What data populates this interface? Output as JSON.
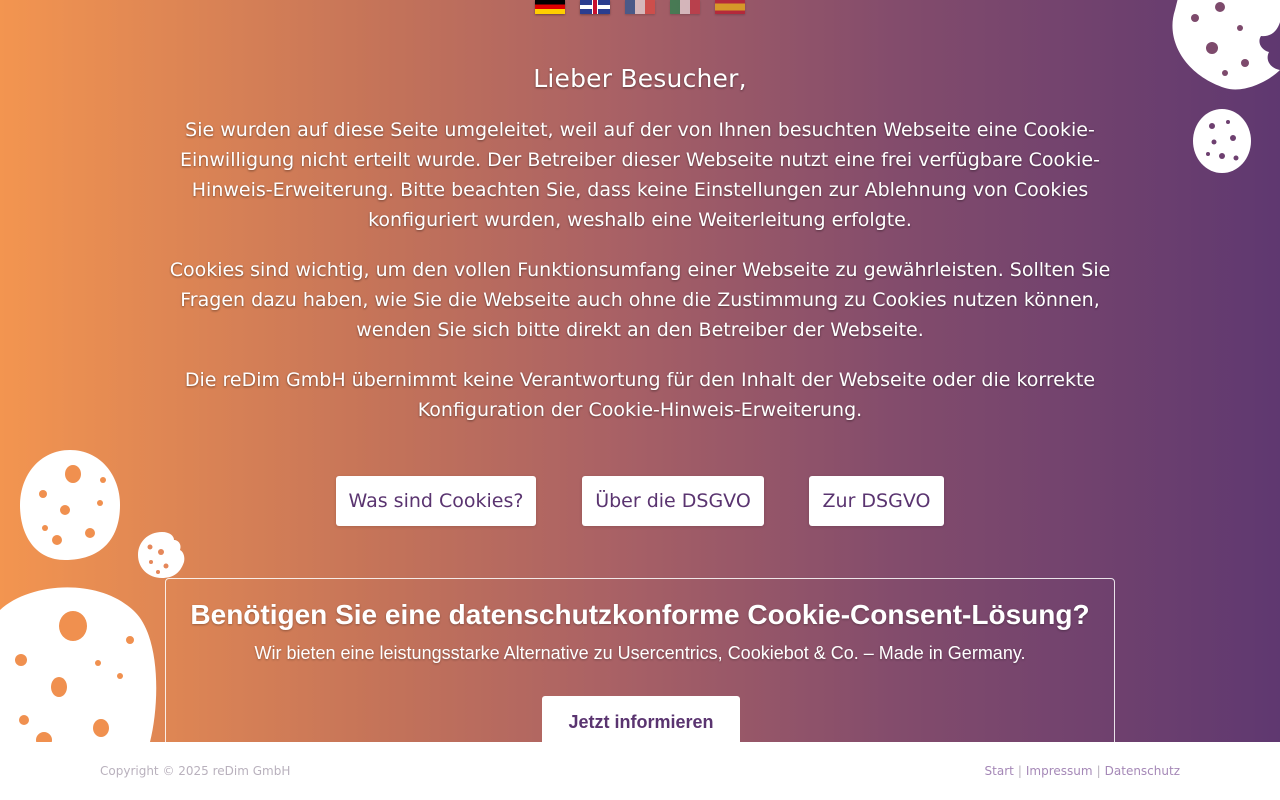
{
  "languages": [
    {
      "code": "de",
      "icon": "flag-germany-icon"
    },
    {
      "code": "en",
      "icon": "flag-uk-icon"
    },
    {
      "code": "fr",
      "icon": "flag-france-icon"
    },
    {
      "code": "it",
      "icon": "flag-italy-icon"
    },
    {
      "code": "es",
      "icon": "flag-spain-icon"
    }
  ],
  "main": {
    "greeting": "Lieber Besucher,",
    "paragraphs": [
      "Sie wurden auf diese Seite umgeleitet, weil auf der von Ihnen besuchten Webseite eine Cookie-Einwilligung nicht erteilt wurde. Der Betreiber dieser Webseite nutzt eine frei verfügbare Cookie-Hinweis-Erweiterung. Bitte beachten Sie, dass keine Einstellungen zur Ablehnung von Cookies konfiguriert wurden, weshalb eine Weiterleitung erfolgte.",
      "Cookies sind wichtig, um den vollen Funktionsumfang einer Webseite zu gewährleisten. Sollten Sie Fragen dazu haben, wie Sie die Webseite auch ohne die Zustimmung zu Cookies nutzen können, wenden Sie sich bitte direkt an den Betreiber der Webseite.",
      "Die reDim GmbH übernimmt keine Verantwortung für den Inhalt der Webseite oder die korrekte Konfiguration der Cookie-Hinweis-Erweiterung."
    ]
  },
  "buttons": {
    "what_are_cookies": "Was sind Cookies?",
    "about_dsgvo": "Über die DSGVO",
    "to_dsgvo": "Zur DSGVO"
  },
  "promo": {
    "title": "Benötigen Sie eine datenschutzkonforme Cookie-Consent-Lösung?",
    "subtitle": "Wir bieten eine leistungsstarke Alternative zu Usercentrics, Cookiebot & Co. – Made in Germany.",
    "cta": "Jetzt informieren"
  },
  "footer": {
    "copyright": "Copyright © 2025 reDim GmbH",
    "links": [
      "Start",
      "Impressum",
      "Datenschutz"
    ],
    "separator": "|"
  },
  "colors": {
    "gradient_start": "#f39550",
    "gradient_end": "#5f3870",
    "button_text": "#5a3470",
    "footer_link": "#a588b7"
  }
}
